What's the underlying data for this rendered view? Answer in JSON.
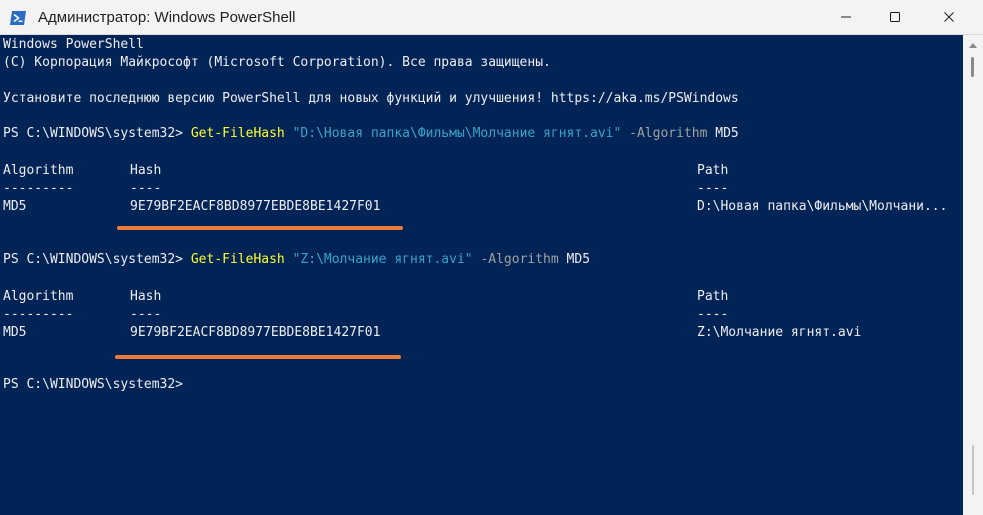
{
  "window": {
    "title": "Администратор: Windows PowerShell",
    "app_icon": "powershell-icon",
    "buttons": {
      "minimize": "minimize-icon",
      "maximize": "maximize-icon",
      "close": "close-icon"
    }
  },
  "colors": {
    "background": "#012456",
    "text": "#eeedf0",
    "command": "#ffff2e",
    "string": "#3aa2c9",
    "parameter": "#a0a0a0",
    "underline": "#f07a3a"
  },
  "console": {
    "banner": [
      "Windows PowerShell",
      "(C) Корпорация Майкрософт (Microsoft Corporation). Все права защищены.",
      "",
      "Установите последнюю версию PowerShell для новых функций и улучшения! https://aka.ms/PSWindows"
    ],
    "commands": [
      {
        "prompt": "PS C:\\WINDOWS\\system32> ",
        "cmdlet": "Get-FileHash",
        "path_arg": "\"D:\\Новая папка\\Фильмы\\Молчание ягнят.avi\"",
        "param": "-Algorithm",
        "param_value": "MD5",
        "headers": {
          "algorithm": "Algorithm",
          "hash": "Hash",
          "path": "Path"
        },
        "separators": {
          "algorithm": "---------",
          "hash": "----",
          "path": "----"
        },
        "row": {
          "algorithm": "MD5",
          "hash": "9E79BF2EACF8BD8977EBDE8BE1427F01",
          "path": "D:\\Новая папка\\Фильмы\\Молчани..."
        }
      },
      {
        "prompt": "PS C:\\WINDOWS\\system32> ",
        "cmdlet": "Get-FileHash",
        "path_arg": "\"Z:\\Молчание ягнят.avi\"",
        "param": "-Algorithm",
        "param_value": "MD5",
        "headers": {
          "algorithm": "Algorithm",
          "hash": "Hash",
          "path": "Path"
        },
        "separators": {
          "algorithm": "---------",
          "hash": "----",
          "path": "----"
        },
        "row": {
          "algorithm": "MD5",
          "hash": "9E79BF2EACF8BD8977EBDE8BE1427F01",
          "path": "Z:\\Молчание ягнят.avi"
        }
      }
    ],
    "final_prompt": "PS C:\\WINDOWS\\system32>"
  }
}
